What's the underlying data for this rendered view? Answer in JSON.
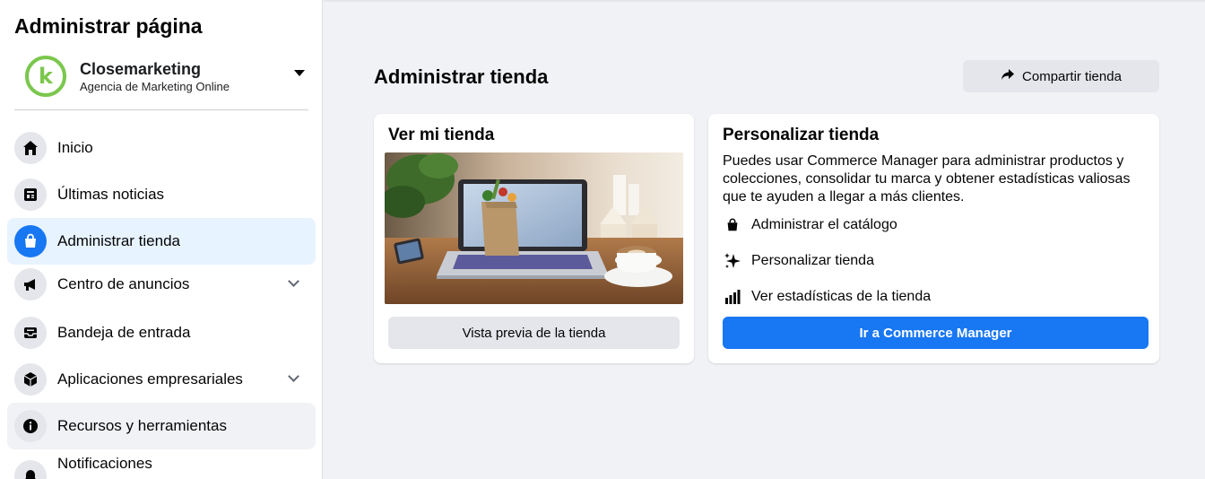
{
  "sidebar": {
    "title": "Administrar página",
    "page": {
      "name": "Closemarketing",
      "subtitle": "Agencia de Marketing Online",
      "logo_letter": "k"
    },
    "items": [
      {
        "label": "Inicio",
        "icon": "home-icon"
      },
      {
        "label": "Últimas noticias",
        "icon": "news-feed-icon"
      },
      {
        "label": "Administrar tienda",
        "icon": "shopping-bag-icon",
        "active": true
      },
      {
        "label": "Centro de anuncios",
        "icon": "megaphone-icon",
        "expandable": true
      },
      {
        "label": "Bandeja de entrada",
        "icon": "inbox-icon"
      },
      {
        "label": "Aplicaciones empresariales",
        "icon": "box-icon",
        "expandable": true
      },
      {
        "label": "Recursos y herramientas",
        "icon": "info-icon"
      },
      {
        "label": "Notificaciones",
        "icon": "bell-icon"
      }
    ]
  },
  "main": {
    "title": "Administrar tienda",
    "share_label": "Compartir tienda",
    "view_card": {
      "title": "Ver mi tienda",
      "preview_label": "Vista previa de la tienda"
    },
    "customize_card": {
      "title": "Personalizar tienda",
      "description": "Puedes usar Commerce Manager para administrar productos y colecciones, consolidar tu marca y obtener estadísticas valiosas que te ayuden a llegar a más clientes.",
      "features": [
        {
          "label": "Administrar el catálogo",
          "icon": "shopping-bag-icon"
        },
        {
          "label": "Personalizar tienda",
          "icon": "sparkle-icon"
        },
        {
          "label": "Ver estadísticas de la tienda",
          "icon": "bar-chart-icon"
        }
      ],
      "cta_label": "Ir a Commerce Manager"
    }
  },
  "colors": {
    "accent": "#1877f2",
    "active_bg": "#e7f3ff",
    "logo_green": "#7bc74d",
    "page_bg": "#f0f2f5"
  }
}
